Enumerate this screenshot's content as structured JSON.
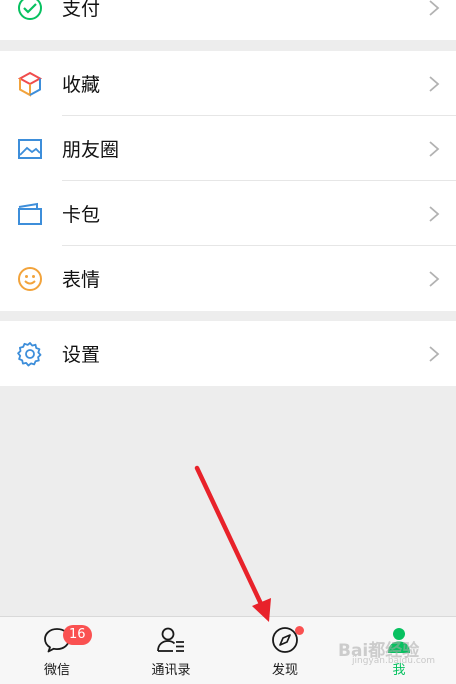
{
  "menu": {
    "pay": {
      "label": "支付",
      "icon": "pay-check-icon",
      "color": "#07c160"
    },
    "favorites": {
      "label": "收藏",
      "icon": "cube-icon"
    },
    "moments": {
      "label": "朋友圈",
      "icon": "picture-icon",
      "color": "#3d8eda"
    },
    "cards": {
      "label": "卡包",
      "icon": "wallet-icon",
      "color": "#3d8eda"
    },
    "stickers": {
      "label": "表情",
      "icon": "smiley-icon",
      "color": "#f2a33b"
    },
    "settings": {
      "label": "设置",
      "icon": "gear-icon",
      "color": "#3d8eda"
    }
  },
  "tabbar": {
    "tabs": [
      {
        "label": "微信",
        "icon": "chat-bubble-icon",
        "badge": "16"
      },
      {
        "label": "通讯录",
        "icon": "contacts-icon"
      },
      {
        "label": "发现",
        "icon": "compass-icon",
        "dot": true
      },
      {
        "label": "我",
        "icon": "person-icon",
        "active": true
      }
    ]
  },
  "watermark": {
    "text": "Bai都经验",
    "sub": "jingyan.baidu.com"
  },
  "colors": {
    "accent": "#07c160",
    "badge": "#fa5151",
    "annotation_arrow": "#e8222a"
  }
}
